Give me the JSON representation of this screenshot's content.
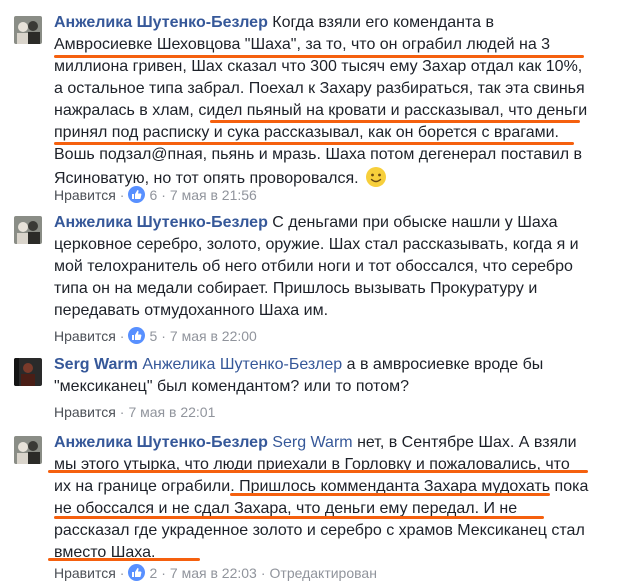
{
  "accent_color": "#f5600e",
  "link_color": "#365899",
  "comments": [
    {
      "author": "Анжелика Шутенко-Безлер",
      "avatar_icon": "profile-photo-couple",
      "text": "Когда взяли его коменданта в Амвросиевке Шеховцова \"Шаха\", за то, что он ограбил людей на 3 миллиона гривен, Шах сказал что 300 тысяч ему Захар отдал как 10%, а остальное типа забрал. Поехал к Захару разбираться, так эта свинья нажралась в хлам, сидел пьяный на кровати и рассказывал, что деньги принял под расписку и сука рассказывал, как он борется с врагами. Вошь подзал@пная, пьянь и мразь. Шаха потом дегенерал поставил в Ясиноватую, но тот опять проворовался.",
      "emoji": "slightly-smiling-face-icon",
      "like_label": "Нравится",
      "reactions": "6",
      "time": "7 мая в 21:56"
    },
    {
      "author": "Анжелика Шутенко-Безлер",
      "avatar_icon": "profile-photo-couple",
      "text": "С деньгами при обыске нашли у Шаха церковное серебро, золото, оружие. Шах стал рассказывать, когда я и мой телохранитель об него отбили ноги и тот обоссался, что серебро типа он на медали собирает. Пришлось вызывать Прокуратуру и передавать отмудоханного Шаха им.",
      "like_label": "Нравится",
      "reactions": "5",
      "time": "7 мая в 22:00"
    },
    {
      "author": "Serg Warm",
      "avatar_icon": "profile-photo-dark",
      "tag": "Анжелика Шутенко-Безлер",
      "text": "а в амвросиевке вроде бы \"мексиканец\" был комендантом? или то потом?",
      "like_label": "Нравится",
      "time": "7 мая в 22:01"
    },
    {
      "author": "Анжелика Шутенко-Безлер",
      "avatar_icon": "profile-photo-couple",
      "tag": "Serg Warm",
      "text": "нет, в Сентябре Шах. А взяли мы этого утырка, что люди приехали в Горловку и пожаловались, что их на границе ограбили. Пришлось комменданта Захара мудохать пока не обоссался и не сдал Захара, что деньги ему передал. И не рассказал где украденное золото и серебро с храмов Мексиканец стал вместо Шаха.",
      "like_label": "Нравится",
      "reactions": "2",
      "time": "7 мая в 22:03",
      "edited": "Отредактирован"
    }
  ]
}
